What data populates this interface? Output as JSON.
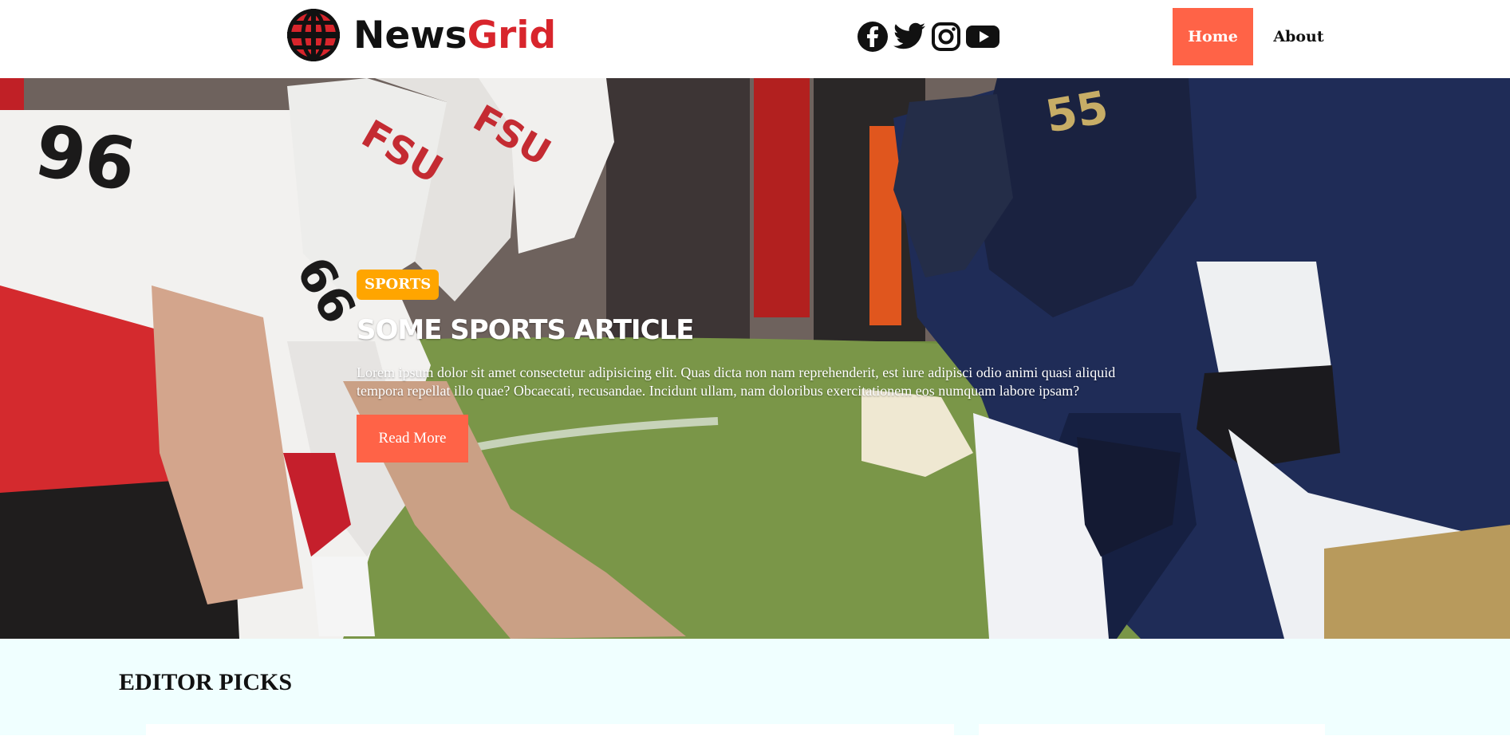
{
  "header": {
    "logo": {
      "word1": "News",
      "word2": "Grid",
      "brand_color": "#d8252c"
    },
    "social": [
      {
        "name": "facebook-icon"
      },
      {
        "name": "twitter-icon"
      },
      {
        "name": "instagram-icon"
      },
      {
        "name": "youtube-icon"
      }
    ],
    "nav": {
      "home_label": "Home",
      "about_label": "About",
      "accent": "#ff6347"
    }
  },
  "hero": {
    "category": "SPORTS",
    "title": "SOME SPORTS ARTICLE",
    "text": "Lorem ipsum dolor sit amet consectetur adipisicing elit. Quas dicta non nam reprehenderit, est iure adipisci odio animi quasi aliquid tempora repellat illo quae? Obcaecati, recusandae. Incidunt ullam, nam doloribus exercitationem eos numquam labore ipsam?",
    "button_label": "Read More",
    "badge_color": "#ffa500"
  },
  "picks": {
    "title": "EDITOR PICKS",
    "background": "#f0ffff"
  }
}
